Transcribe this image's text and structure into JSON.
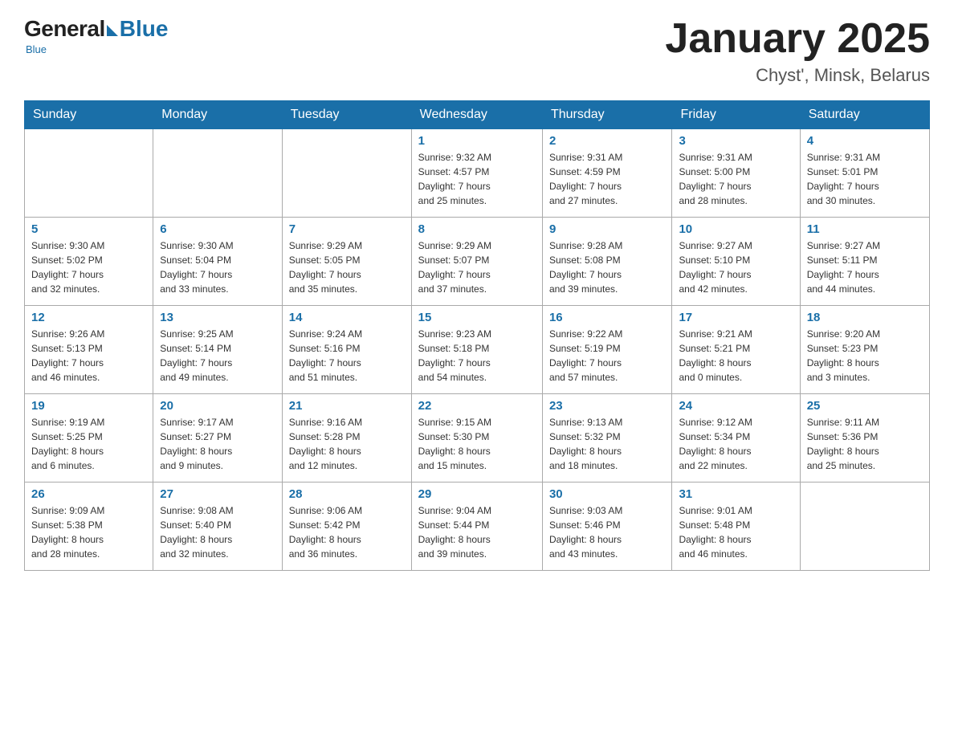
{
  "logo": {
    "general": "General",
    "blue": "Blue",
    "tagline": "Blue"
  },
  "header": {
    "month": "January 2025",
    "location": "Chyst', Minsk, Belarus"
  },
  "weekdays": [
    "Sunday",
    "Monday",
    "Tuesday",
    "Wednesday",
    "Thursday",
    "Friday",
    "Saturday"
  ],
  "weeks": [
    [
      {
        "day": "",
        "info": ""
      },
      {
        "day": "",
        "info": ""
      },
      {
        "day": "",
        "info": ""
      },
      {
        "day": "1",
        "info": "Sunrise: 9:32 AM\nSunset: 4:57 PM\nDaylight: 7 hours\nand 25 minutes."
      },
      {
        "day": "2",
        "info": "Sunrise: 9:31 AM\nSunset: 4:59 PM\nDaylight: 7 hours\nand 27 minutes."
      },
      {
        "day": "3",
        "info": "Sunrise: 9:31 AM\nSunset: 5:00 PM\nDaylight: 7 hours\nand 28 minutes."
      },
      {
        "day": "4",
        "info": "Sunrise: 9:31 AM\nSunset: 5:01 PM\nDaylight: 7 hours\nand 30 minutes."
      }
    ],
    [
      {
        "day": "5",
        "info": "Sunrise: 9:30 AM\nSunset: 5:02 PM\nDaylight: 7 hours\nand 32 minutes."
      },
      {
        "day": "6",
        "info": "Sunrise: 9:30 AM\nSunset: 5:04 PM\nDaylight: 7 hours\nand 33 minutes."
      },
      {
        "day": "7",
        "info": "Sunrise: 9:29 AM\nSunset: 5:05 PM\nDaylight: 7 hours\nand 35 minutes."
      },
      {
        "day": "8",
        "info": "Sunrise: 9:29 AM\nSunset: 5:07 PM\nDaylight: 7 hours\nand 37 minutes."
      },
      {
        "day": "9",
        "info": "Sunrise: 9:28 AM\nSunset: 5:08 PM\nDaylight: 7 hours\nand 39 minutes."
      },
      {
        "day": "10",
        "info": "Sunrise: 9:27 AM\nSunset: 5:10 PM\nDaylight: 7 hours\nand 42 minutes."
      },
      {
        "day": "11",
        "info": "Sunrise: 9:27 AM\nSunset: 5:11 PM\nDaylight: 7 hours\nand 44 minutes."
      }
    ],
    [
      {
        "day": "12",
        "info": "Sunrise: 9:26 AM\nSunset: 5:13 PM\nDaylight: 7 hours\nand 46 minutes."
      },
      {
        "day": "13",
        "info": "Sunrise: 9:25 AM\nSunset: 5:14 PM\nDaylight: 7 hours\nand 49 minutes."
      },
      {
        "day": "14",
        "info": "Sunrise: 9:24 AM\nSunset: 5:16 PM\nDaylight: 7 hours\nand 51 minutes."
      },
      {
        "day": "15",
        "info": "Sunrise: 9:23 AM\nSunset: 5:18 PM\nDaylight: 7 hours\nand 54 minutes."
      },
      {
        "day": "16",
        "info": "Sunrise: 9:22 AM\nSunset: 5:19 PM\nDaylight: 7 hours\nand 57 minutes."
      },
      {
        "day": "17",
        "info": "Sunrise: 9:21 AM\nSunset: 5:21 PM\nDaylight: 8 hours\nand 0 minutes."
      },
      {
        "day": "18",
        "info": "Sunrise: 9:20 AM\nSunset: 5:23 PM\nDaylight: 8 hours\nand 3 minutes."
      }
    ],
    [
      {
        "day": "19",
        "info": "Sunrise: 9:19 AM\nSunset: 5:25 PM\nDaylight: 8 hours\nand 6 minutes."
      },
      {
        "day": "20",
        "info": "Sunrise: 9:17 AM\nSunset: 5:27 PM\nDaylight: 8 hours\nand 9 minutes."
      },
      {
        "day": "21",
        "info": "Sunrise: 9:16 AM\nSunset: 5:28 PM\nDaylight: 8 hours\nand 12 minutes."
      },
      {
        "day": "22",
        "info": "Sunrise: 9:15 AM\nSunset: 5:30 PM\nDaylight: 8 hours\nand 15 minutes."
      },
      {
        "day": "23",
        "info": "Sunrise: 9:13 AM\nSunset: 5:32 PM\nDaylight: 8 hours\nand 18 minutes."
      },
      {
        "day": "24",
        "info": "Sunrise: 9:12 AM\nSunset: 5:34 PM\nDaylight: 8 hours\nand 22 minutes."
      },
      {
        "day": "25",
        "info": "Sunrise: 9:11 AM\nSunset: 5:36 PM\nDaylight: 8 hours\nand 25 minutes."
      }
    ],
    [
      {
        "day": "26",
        "info": "Sunrise: 9:09 AM\nSunset: 5:38 PM\nDaylight: 8 hours\nand 28 minutes."
      },
      {
        "day": "27",
        "info": "Sunrise: 9:08 AM\nSunset: 5:40 PM\nDaylight: 8 hours\nand 32 minutes."
      },
      {
        "day": "28",
        "info": "Sunrise: 9:06 AM\nSunset: 5:42 PM\nDaylight: 8 hours\nand 36 minutes."
      },
      {
        "day": "29",
        "info": "Sunrise: 9:04 AM\nSunset: 5:44 PM\nDaylight: 8 hours\nand 39 minutes."
      },
      {
        "day": "30",
        "info": "Sunrise: 9:03 AM\nSunset: 5:46 PM\nDaylight: 8 hours\nand 43 minutes."
      },
      {
        "day": "31",
        "info": "Sunrise: 9:01 AM\nSunset: 5:48 PM\nDaylight: 8 hours\nand 46 minutes."
      },
      {
        "day": "",
        "info": ""
      }
    ]
  ]
}
